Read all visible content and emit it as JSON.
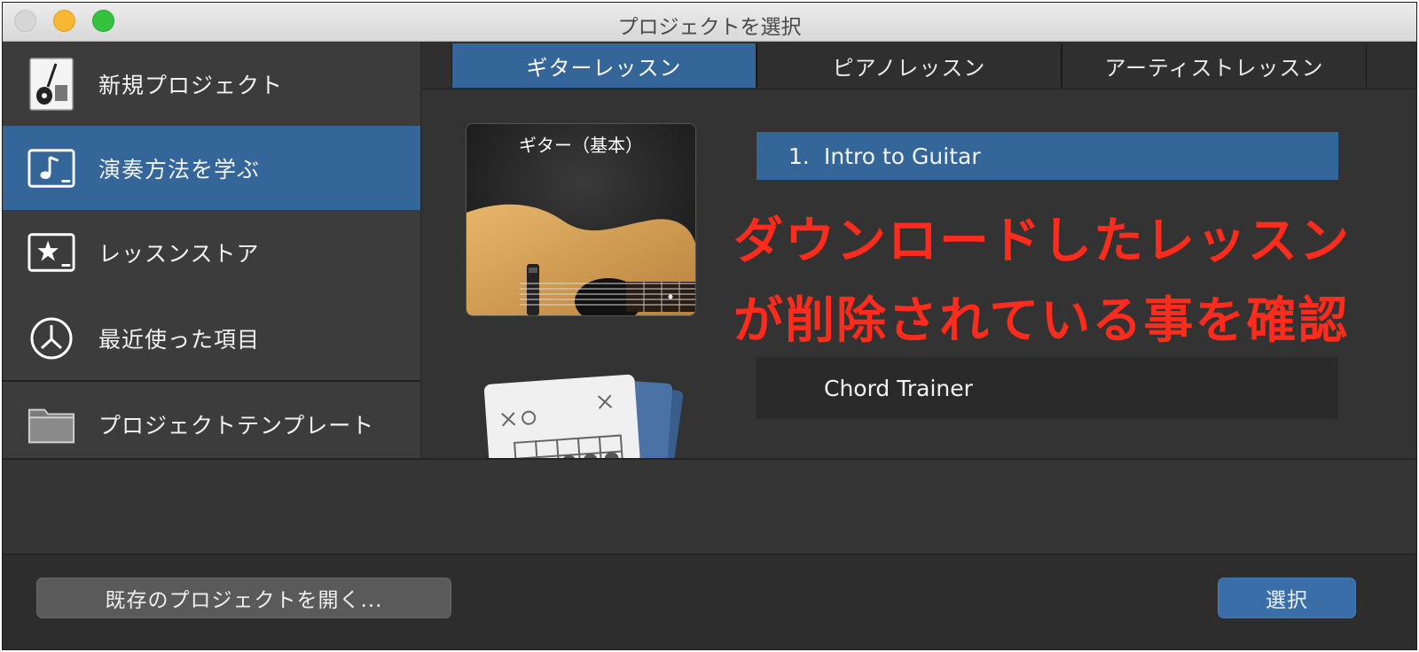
{
  "window": {
    "title": "プロジェクトを選択"
  },
  "sidebar": {
    "items": [
      {
        "label": "新規プロジェクト",
        "icon": "guitar-project-icon",
        "active": false
      },
      {
        "label": "演奏方法を学ぶ",
        "icon": "music-note-icon",
        "active": true
      },
      {
        "label": "レッスンストア",
        "icon": "star-icon",
        "active": false
      },
      {
        "label": "最近使った項目",
        "icon": "clock-icon",
        "active": false
      },
      {
        "label": "プロジェクトテンプレート",
        "icon": "folder-icon",
        "active": false
      }
    ]
  },
  "tabs": [
    {
      "label": "ギターレッスン",
      "active": true
    },
    {
      "label": "ピアノレッスン",
      "active": false
    },
    {
      "label": "アーティストレッスン",
      "active": false
    }
  ],
  "lesson_group": {
    "title": "ギター（基本）"
  },
  "lessons": [
    {
      "number": "1.",
      "title": "Intro to Guitar",
      "selected": true
    },
    {
      "number": "",
      "title": "Chord Trainer",
      "selected": false
    }
  ],
  "annotation": {
    "line1": "ダウンロードしたレッスン",
    "line2": "が削除されている事を確認",
    "color": "#ff2b1c"
  },
  "footer": {
    "open_existing_label": "既存のプロジェクトを開く...",
    "select_label": "選択"
  },
  "colors": {
    "accent": "#346699",
    "sidebar_bg": "#3c3c3c",
    "main_bg": "#333333"
  }
}
